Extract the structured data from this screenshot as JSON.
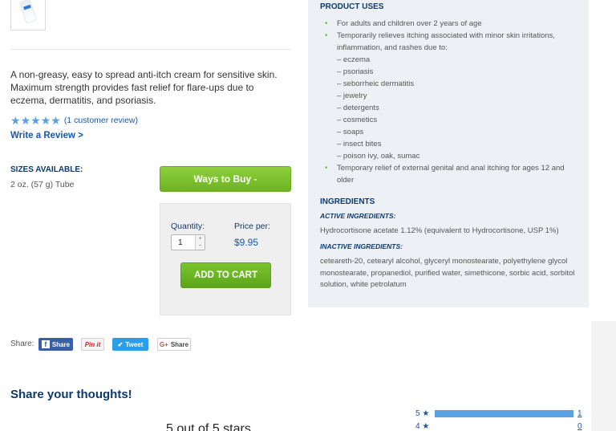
{
  "product": {
    "description": "A non-greasy, easy to spread anti-itch cream for sensitive skin. Maximum strength provides fast relief for flare-ups due to eczema, dermatitis, and psoriasis.",
    "review_count_text": "(1 customer review)",
    "rating_stars": 5,
    "write_review": "Write a Review >",
    "sizes_label": "SIZES AVAILABLE:",
    "sizes_value": "2 oz. (57 g) Tube"
  },
  "buy": {
    "ways_label": "Ways to Buy -",
    "quantity_label": "Quantity:",
    "quantity_value": "1",
    "price_label": "Price per:",
    "price_value": "$9.95",
    "add_to_cart": "ADD TO CART"
  },
  "share": {
    "label": "Share:",
    "facebook": "Share",
    "pinterest": "Pin it",
    "twitter": "Tweet",
    "google": "Share"
  },
  "reviews": {
    "heading": "Share your thoughts!",
    "summary": "5 out of 5 stars",
    "bars": [
      {
        "stars": "5 ★",
        "count": "1",
        "fraction": 1.0
      },
      {
        "stars": "4 ★",
        "count": "0",
        "fraction": 0.0
      }
    ]
  },
  "panel": {
    "uses_heading": "PRODUCT USES",
    "uses": [
      "For adults and children over 2 years of age",
      "Temporarily relieves itching associated with minor skin irritations, inflammation, and rashes due to:"
    ],
    "sub_items": [
      "– eczema",
      "– psoriasis",
      "– seborrheic dermatitis",
      "– jewelry",
      "– detergents",
      "– cosmetics",
      "– soaps",
      "– insect bites",
      "– poison ivy, oak, sumac"
    ],
    "uses_last": "Temporary relief of external genital and anal itching for ages 12 and older",
    "ingredients_heading": "INGREDIENTS",
    "active_heading": "ACTIVE INGREDIENTS:",
    "active_text": "Hydrocortisone acetate 1.12% (equivalent to Hydrocortisone, USP 1%)",
    "inactive_heading": "INACTIVE INGREDIENTS:",
    "inactive_text": "ceteareth-20, cetearyl alcohol, glyceryl monostearate, polyethylene glycol monostearate, propanediol, purified water, simethicone, sorbic acid, sorbitol solution, white petrolatum"
  },
  "colors": {
    "accent_blue": "#1a58a8",
    "heading_navy": "#0d3a6b",
    "button_green": "#6db420",
    "star_blue": "#5aa1e2"
  }
}
